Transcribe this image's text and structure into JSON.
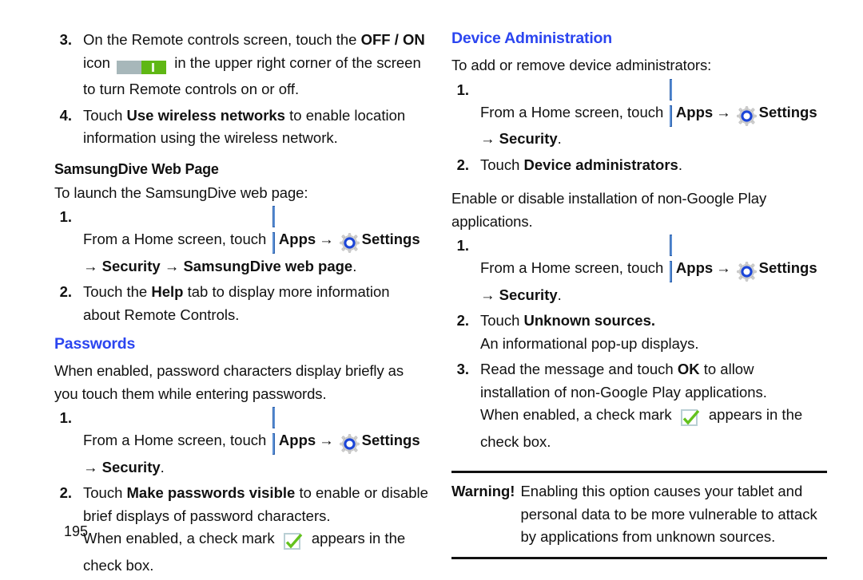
{
  "document": {
    "page_number": "195",
    "accent_blue": "#2b45f0",
    "check_green": "#63c21d",
    "toggle_green": "#5fb714",
    "toggle_gray": "#a7b7ba",
    "apps_icon_blue": "#5b8fd4"
  },
  "left_column": {
    "step3": {
      "number": "3.",
      "text_a": "On the Remote controls screen, touch the ",
      "bold_a": "OFF / ON",
      "text_b": " icon ",
      "toggle_icon": "toggle-switch-on-icon",
      "text_c": " in the upper right corner of the screen to turn Remote controls on or off."
    },
    "step4": {
      "number": "4.",
      "text_a": "Touch ",
      "bold_a": "Use wireless networks",
      "text_b": " to enable location information using the wireless network."
    },
    "samsungdive": {
      "heading": "SamsungDive Web Page",
      "intro": "To launch the SamsungDive web page:",
      "step1": {
        "number": "1.",
        "text_a": "From a Home screen, touch ",
        "apps_icon": "apps-grid-icon",
        "bold_apps": "Apps",
        "arrow1": "→",
        "gear_icon": "settings-gear-icon",
        "bold_settings": "Settings",
        "arrow2": "→",
        "bold_security": "Security",
        "arrow3": "→",
        "bold_target": "SamsungDive web page",
        "period": "."
      },
      "step2": {
        "number": "2.",
        "text_a": "Touch the ",
        "bold_a": "Help",
        "text_b": " tab to display more information about Remote Controls."
      }
    },
    "passwords": {
      "heading": "Passwords",
      "intro": "When enabled, password characters display briefly as you touch them while entering passwords.",
      "step1": {
        "number": "1.",
        "text_a": "From a Home screen, touch ",
        "apps_icon": "apps-grid-icon",
        "bold_apps": "Apps",
        "arrow1": "→",
        "gear_icon": "settings-gear-icon",
        "bold_settings": "Settings",
        "arrow2": "→",
        "bold_security": "Security",
        "period": "."
      },
      "step2": {
        "number": "2.",
        "text_a": "Touch ",
        "bold_a": "Make passwords visible",
        "text_b": " to enable or disable brief displays of password characters.",
        "sub_text_a": "When enabled, a check mark ",
        "check_icon": "green-checkmark-box-icon",
        "sub_text_b": " appears in the check box."
      }
    }
  },
  "right_column": {
    "device_administration": {
      "heading": "Device Administration",
      "intro": "To add or remove device administrators:",
      "step1": {
        "number": "1.",
        "text_a": "From a Home screen, touch ",
        "apps_icon": "apps-grid-icon",
        "bold_apps": "Apps",
        "arrow1": "→",
        "gear_icon": "settings-gear-icon",
        "bold_settings": "Settings",
        "arrow2": "→",
        "bold_security": "Security",
        "period": "."
      },
      "step2": {
        "number": "2.",
        "text_a": "Touch ",
        "bold_a": "Device administrators",
        "text_b": "."
      }
    },
    "unknown_sources": {
      "intro": "Enable or disable installation of non-Google Play applications.",
      "step1": {
        "number": "1.",
        "text_a": "From a Home screen, touch ",
        "apps_icon": "apps-grid-icon",
        "bold_apps": "Apps",
        "arrow1": "→",
        "gear_icon": "settings-gear-icon",
        "bold_settings": "Settings",
        "arrow2": "→",
        "bold_security": "Security",
        "period": "."
      },
      "step2": {
        "number": "2.",
        "text_a": "Touch ",
        "bold_a": "Unknown sources.",
        "sub_text": "An informational pop-up displays."
      },
      "step3": {
        "number": "3.",
        "text_a": "Read the message and touch ",
        "bold_a": "OK",
        "text_b": " to allow installation of non-Google Play applications.",
        "sub_text_a": "When enabled, a check mark ",
        "check_icon": "green-checkmark-box-icon",
        "sub_text_b": " appears in the check box."
      }
    },
    "warning": {
      "label": "Warning!",
      "text": "Enabling this option causes your tablet and personal data to be more vulnerable to attack by applications from unknown sources."
    }
  }
}
